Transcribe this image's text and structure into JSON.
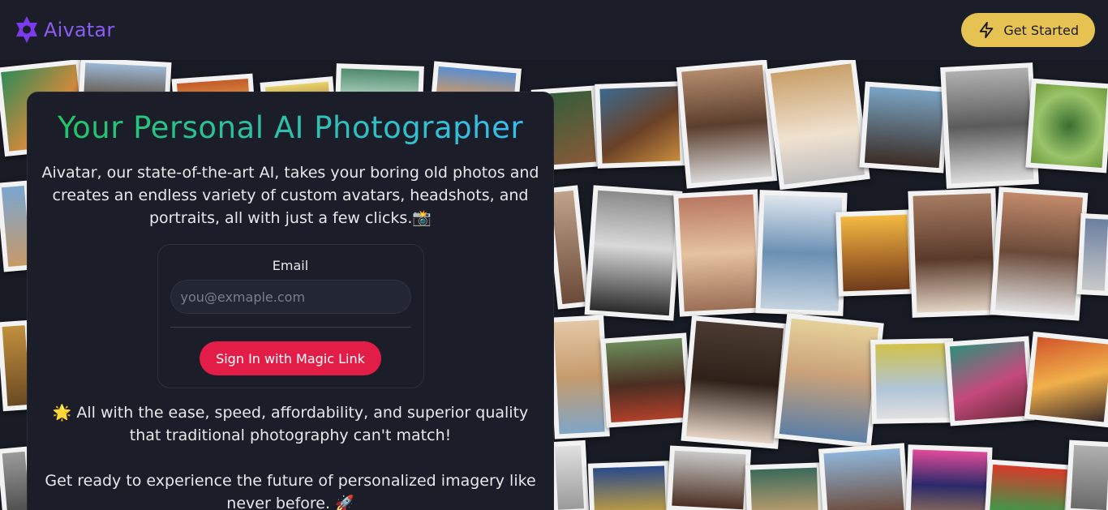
{
  "header": {
    "brand_name": "Aivatar",
    "cta_label": "Get Started",
    "colors": {
      "brand": "#8b5cf6",
      "cta": "#e6c253"
    }
  },
  "hero": {
    "headline": "Your Personal AI Photographer",
    "intro": "Aivatar, our state-of-the-art AI, takes your boring old photos and creates an endless variety of custom avatars, headshots, and portraits, all with just a few clicks.",
    "outro": "All with the ease, speed, affordability, and superior quality that traditional photography can't match!",
    "outro2": "Get ready to experience the future of personalized imagery like never before."
  },
  "signin": {
    "email_label": "Email",
    "email_placeholder": "you@exmaple.com",
    "button_label": "Sign In with Magic Link",
    "button_color": "#e11d48"
  }
}
